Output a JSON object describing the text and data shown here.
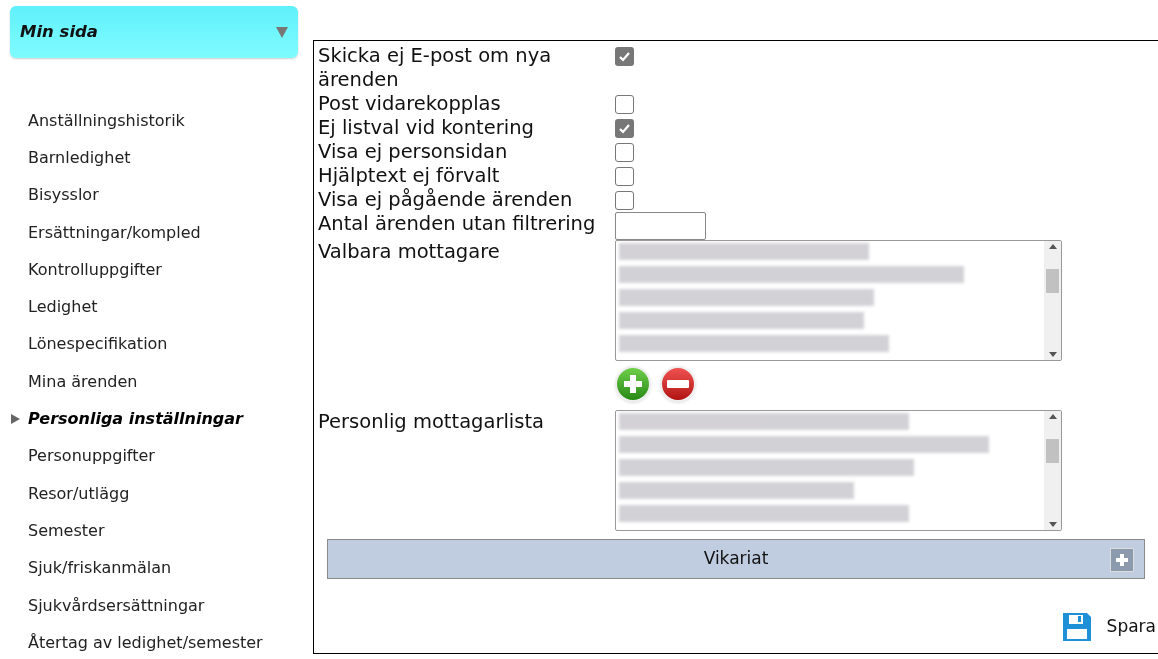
{
  "menu_header": {
    "title": "Min sida",
    "expanded": true
  },
  "sidebar": {
    "items": [
      {
        "label": "Anställningshistorik",
        "selected": false
      },
      {
        "label": "Barnledighet",
        "selected": false
      },
      {
        "label": "Bisysslor",
        "selected": false
      },
      {
        "label": "Ersättningar/kompled",
        "selected": false
      },
      {
        "label": "Kontrolluppgifter",
        "selected": false
      },
      {
        "label": "Ledighet",
        "selected": false
      },
      {
        "label": "Lönespecifikation",
        "selected": false
      },
      {
        "label": "Mina ärenden",
        "selected": false
      },
      {
        "label": "Personliga inställningar",
        "selected": true
      },
      {
        "label": "Personuppgifter",
        "selected": false
      },
      {
        "label": "Resor/utlägg",
        "selected": false
      },
      {
        "label": "Semester",
        "selected": false
      },
      {
        "label": "Sjuk/friskanmälan",
        "selected": false
      },
      {
        "label": "Sjukvårdsersättningar",
        "selected": false
      },
      {
        "label": "Återtag av ledighet/semester",
        "selected": false
      }
    ]
  },
  "settings": [
    {
      "kind": "checkbox",
      "label": "Skicka ej E-post om nya ärenden",
      "checked": true
    },
    {
      "kind": "checkbox",
      "label": "Post vidarekopplas",
      "checked": false
    },
    {
      "kind": "checkbox",
      "label": "Ej listval vid kontering",
      "checked": true
    },
    {
      "kind": "checkbox",
      "label": "Visa ej personsidan",
      "checked": false
    },
    {
      "kind": "checkbox",
      "label": "Hjälptext ej förvalt",
      "checked": false
    },
    {
      "kind": "checkbox",
      "label": "Visa ej pågående ärenden",
      "checked": false
    },
    {
      "kind": "text",
      "label": "Antal ärenden utan filtrering"
    },
    {
      "kind": "listbox",
      "label": "Valbara mottagare",
      "buttons": true,
      "entries": [
        {
          "kind": "blurred"
        },
        {
          "kind": "blurred"
        },
        {
          "kind": "blurred"
        },
        {
          "kind": "blurred"
        },
        {
          "kind": "blurred"
        }
      ]
    },
    {
      "kind": "listbox",
      "label": "Personlig mottagarlista",
      "buttons": false,
      "entries": [
        {
          "kind": "blurred"
        },
        {
          "kind": "blurred"
        },
        {
          "kind": "blurred"
        },
        {
          "kind": "blurred"
        },
        {
          "kind": "blurred"
        }
      ]
    }
  ],
  "section": {
    "title": "Vikariat",
    "expanded": false
  },
  "save_button": {
    "label": "Spara"
  }
}
